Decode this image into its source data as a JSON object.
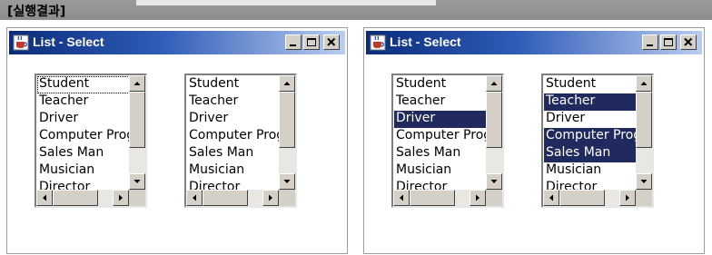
{
  "header": {
    "title": "[실행결과]"
  },
  "windows": [
    {
      "title": "List - Select",
      "lists": [
        {
          "items": [
            "Student",
            "Teacher",
            "Driver",
            "Computer Programmer",
            "Sales Man",
            "Musician",
            "Director"
          ],
          "selected": [],
          "focused": "Student"
        },
        {
          "items": [
            "Student",
            "Teacher",
            "Driver",
            "Computer Programmer",
            "Sales Man",
            "Musician",
            "Director"
          ],
          "selected": []
        }
      ]
    },
    {
      "title": "List - Select",
      "lists": [
        {
          "items": [
            "Student",
            "Teacher",
            "Driver",
            "Computer Programmer",
            "Sales Man",
            "Musician",
            "Director"
          ],
          "selected": [
            "Driver"
          ]
        },
        {
          "items": [
            "Student",
            "Teacher",
            "Driver",
            "Computer Programmer",
            "Sales Man",
            "Musician",
            "Director"
          ],
          "selected": [
            "Teacher",
            "Computer Programmer",
            "Sales Man"
          ]
        }
      ]
    }
  ],
  "colors": {
    "selection": "#212a5e",
    "titlebar_start": "#0b2c7a",
    "titlebar_end": "#b9cdf0",
    "header_bar": "#8d8d8d"
  },
  "icons": [
    "java-cup-icon",
    "minimize-icon",
    "maximize-icon",
    "close-icon",
    "scroll-up-icon",
    "scroll-down-icon",
    "scroll-left-icon",
    "scroll-right-icon"
  ]
}
